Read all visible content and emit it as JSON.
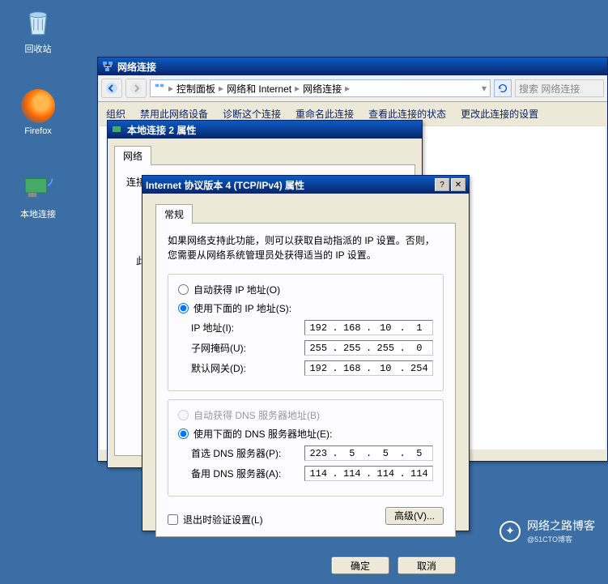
{
  "desktop": {
    "recycle_bin": "回收站",
    "firefox": "Firefox",
    "local_connection": "本地连接"
  },
  "network_window": {
    "title": "网络连接",
    "breadcrumb": {
      "control_panel": "控制面板",
      "network_internet": "网络和 Internet",
      "network_connections": "网络连接"
    },
    "search_placeholder": "搜索 网络连接",
    "menu": {
      "organize": "组织",
      "disable": "禁用此网络设备",
      "diagnose": "诊断这个连接",
      "rename": "重命名此连接",
      "view_status": "查看此连接的状态",
      "change_settings": "更改此连接的设置"
    }
  },
  "props_window": {
    "title": "本地连接 2 属性",
    "tab_network": "网络",
    "connect_using_prefix": "连接时使用:",
    "placeholder_text": "此"
  },
  "ipv4_window": {
    "title": "Internet 协议版本 4 (TCP/IPv4) 属性",
    "tab_general": "常规",
    "description": "如果网络支持此功能，则可以获取自动指派的 IP 设置。否则，您需要从网络系统管理员处获得适当的 IP 设置。",
    "radio_auto_ip": "自动获得 IP 地址(O)",
    "radio_manual_ip": "使用下面的 IP 地址(S):",
    "label_ip": "IP 地址(I):",
    "label_subnet": "子网掩码(U):",
    "label_gateway": "默认网关(D):",
    "ip": {
      "a": "192",
      "b": "168",
      "c": "10",
      "d": "1"
    },
    "subnet": {
      "a": "255",
      "b": "255",
      "c": "255",
      "d": "0"
    },
    "gateway": {
      "a": "192",
      "b": "168",
      "c": "10",
      "d": "254"
    },
    "radio_auto_dns": "自动获得 DNS 服务器地址(B)",
    "radio_manual_dns": "使用下面的 DNS 服务器地址(E):",
    "label_dns1": "首选 DNS 服务器(P):",
    "label_dns2": "备用 DNS 服务器(A):",
    "dns1": {
      "a": "223",
      "b": "5",
      "c": "5",
      "d": "5"
    },
    "dns2": {
      "a": "114",
      "b": "114",
      "c": "114",
      "d": "114"
    },
    "validate_on_exit": "退出时验证设置(L)",
    "btn_advanced": "高级(V)...",
    "btn_ok": "确定",
    "btn_cancel": "取消"
  },
  "watermark": {
    "name": "网络之路博客",
    "sub": "@51CTO博客"
  }
}
